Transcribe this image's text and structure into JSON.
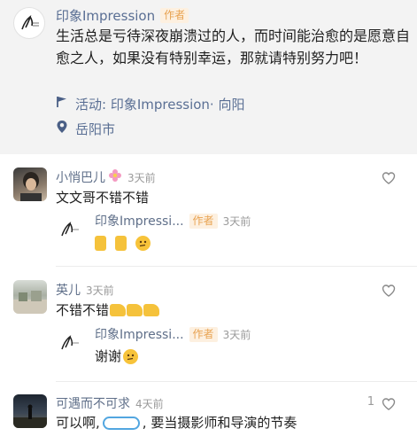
{
  "post": {
    "author": "印象Impression",
    "author_tag": "作者",
    "body": "生活总是亏待深夜崩溃过的人，而时间能治愈的是愿意自愈之人，如果没有特别幸运，那就请特别努力吧！",
    "activity": "活动: 印象Impression· 向阳",
    "location": "岳阳市"
  },
  "comments": [
    {
      "name": "小悄巴儿",
      "time": "3天前",
      "text": "文文哥不错不错",
      "reply": {
        "name": "印象Impressi...",
        "tag": "作者",
        "time": "3天前",
        "text": ""
      }
    },
    {
      "name": "英儿",
      "time": "3天前",
      "text": "不错不错",
      "reply": {
        "name": "印象Impressi...",
        "tag": "作者",
        "time": "3天前",
        "text": "谢谢"
      }
    },
    {
      "name": "可遇而不可求",
      "time": "4天前",
      "likes": "1",
      "text_before": "可以啊,",
      "text_after": ", 要当摄影师和导演的节奏"
    }
  ],
  "colors": {
    "name_link": "#5a6f94",
    "author_tag": "#e8a352",
    "author_tag_bg": "#fdf0e0",
    "post_bg": "#f3f3f3"
  },
  "icons": [
    "flag-icon",
    "location-pin-icon",
    "heart-icon",
    "crossed-fingers-emoji",
    "thinking-emoji",
    "thumbs-up-emoji"
  ]
}
